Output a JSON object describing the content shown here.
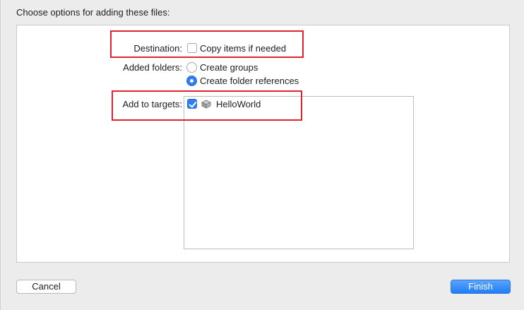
{
  "dialog": {
    "heading": "Choose options for adding these files:"
  },
  "destination": {
    "label": "Destination:",
    "option_label": "Copy items if needed",
    "checked": false
  },
  "added_folders": {
    "label": "Added folders:",
    "options": [
      {
        "label": "Create groups",
        "selected": false
      },
      {
        "label": "Create folder references",
        "selected": true
      }
    ]
  },
  "targets": {
    "label": "Add to targets:",
    "items": [
      {
        "name": "HelloWorld",
        "checked": true,
        "icon": "app-target-icon"
      }
    ]
  },
  "buttons": {
    "cancel_label": "Cancel",
    "finish_label": "Finish"
  },
  "colors": {
    "accent": "#2f7cf6",
    "highlight": "#e0222f"
  }
}
